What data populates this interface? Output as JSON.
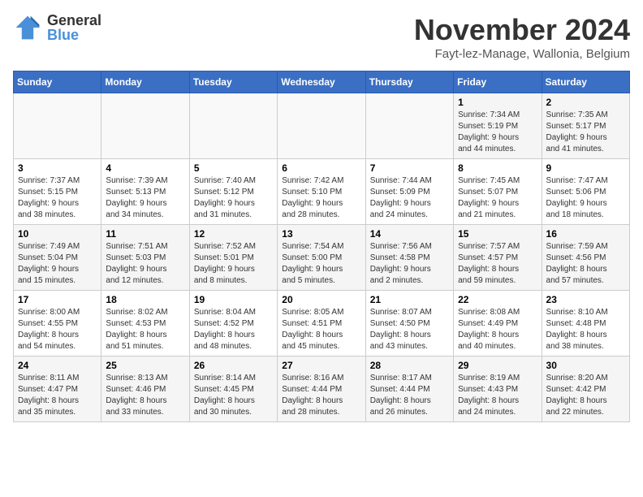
{
  "logo": {
    "general": "General",
    "blue": "Blue"
  },
  "title": "November 2024",
  "location": "Fayt-lez-Manage, Wallonia, Belgium",
  "weekdays": [
    "Sunday",
    "Monday",
    "Tuesday",
    "Wednesday",
    "Thursday",
    "Friday",
    "Saturday"
  ],
  "weeks": [
    [
      {
        "day": "",
        "info": ""
      },
      {
        "day": "",
        "info": ""
      },
      {
        "day": "",
        "info": ""
      },
      {
        "day": "",
        "info": ""
      },
      {
        "day": "",
        "info": ""
      },
      {
        "day": "1",
        "info": "Sunrise: 7:34 AM\nSunset: 5:19 PM\nDaylight: 9 hours\nand 44 minutes."
      },
      {
        "day": "2",
        "info": "Sunrise: 7:35 AM\nSunset: 5:17 PM\nDaylight: 9 hours\nand 41 minutes."
      }
    ],
    [
      {
        "day": "3",
        "info": "Sunrise: 7:37 AM\nSunset: 5:15 PM\nDaylight: 9 hours\nand 38 minutes."
      },
      {
        "day": "4",
        "info": "Sunrise: 7:39 AM\nSunset: 5:13 PM\nDaylight: 9 hours\nand 34 minutes."
      },
      {
        "day": "5",
        "info": "Sunrise: 7:40 AM\nSunset: 5:12 PM\nDaylight: 9 hours\nand 31 minutes."
      },
      {
        "day": "6",
        "info": "Sunrise: 7:42 AM\nSunset: 5:10 PM\nDaylight: 9 hours\nand 28 minutes."
      },
      {
        "day": "7",
        "info": "Sunrise: 7:44 AM\nSunset: 5:09 PM\nDaylight: 9 hours\nand 24 minutes."
      },
      {
        "day": "8",
        "info": "Sunrise: 7:45 AM\nSunset: 5:07 PM\nDaylight: 9 hours\nand 21 minutes."
      },
      {
        "day": "9",
        "info": "Sunrise: 7:47 AM\nSunset: 5:06 PM\nDaylight: 9 hours\nand 18 minutes."
      }
    ],
    [
      {
        "day": "10",
        "info": "Sunrise: 7:49 AM\nSunset: 5:04 PM\nDaylight: 9 hours\nand 15 minutes."
      },
      {
        "day": "11",
        "info": "Sunrise: 7:51 AM\nSunset: 5:03 PM\nDaylight: 9 hours\nand 12 minutes."
      },
      {
        "day": "12",
        "info": "Sunrise: 7:52 AM\nSunset: 5:01 PM\nDaylight: 9 hours\nand 8 minutes."
      },
      {
        "day": "13",
        "info": "Sunrise: 7:54 AM\nSunset: 5:00 PM\nDaylight: 9 hours\nand 5 minutes."
      },
      {
        "day": "14",
        "info": "Sunrise: 7:56 AM\nSunset: 4:58 PM\nDaylight: 9 hours\nand 2 minutes."
      },
      {
        "day": "15",
        "info": "Sunrise: 7:57 AM\nSunset: 4:57 PM\nDaylight: 8 hours\nand 59 minutes."
      },
      {
        "day": "16",
        "info": "Sunrise: 7:59 AM\nSunset: 4:56 PM\nDaylight: 8 hours\nand 57 minutes."
      }
    ],
    [
      {
        "day": "17",
        "info": "Sunrise: 8:00 AM\nSunset: 4:55 PM\nDaylight: 8 hours\nand 54 minutes."
      },
      {
        "day": "18",
        "info": "Sunrise: 8:02 AM\nSunset: 4:53 PM\nDaylight: 8 hours\nand 51 minutes."
      },
      {
        "day": "19",
        "info": "Sunrise: 8:04 AM\nSunset: 4:52 PM\nDaylight: 8 hours\nand 48 minutes."
      },
      {
        "day": "20",
        "info": "Sunrise: 8:05 AM\nSunset: 4:51 PM\nDaylight: 8 hours\nand 45 minutes."
      },
      {
        "day": "21",
        "info": "Sunrise: 8:07 AM\nSunset: 4:50 PM\nDaylight: 8 hours\nand 43 minutes."
      },
      {
        "day": "22",
        "info": "Sunrise: 8:08 AM\nSunset: 4:49 PM\nDaylight: 8 hours\nand 40 minutes."
      },
      {
        "day": "23",
        "info": "Sunrise: 8:10 AM\nSunset: 4:48 PM\nDaylight: 8 hours\nand 38 minutes."
      }
    ],
    [
      {
        "day": "24",
        "info": "Sunrise: 8:11 AM\nSunset: 4:47 PM\nDaylight: 8 hours\nand 35 minutes."
      },
      {
        "day": "25",
        "info": "Sunrise: 8:13 AM\nSunset: 4:46 PM\nDaylight: 8 hours\nand 33 minutes."
      },
      {
        "day": "26",
        "info": "Sunrise: 8:14 AM\nSunset: 4:45 PM\nDaylight: 8 hours\nand 30 minutes."
      },
      {
        "day": "27",
        "info": "Sunrise: 8:16 AM\nSunset: 4:44 PM\nDaylight: 8 hours\nand 28 minutes."
      },
      {
        "day": "28",
        "info": "Sunrise: 8:17 AM\nSunset: 4:44 PM\nDaylight: 8 hours\nand 26 minutes."
      },
      {
        "day": "29",
        "info": "Sunrise: 8:19 AM\nSunset: 4:43 PM\nDaylight: 8 hours\nand 24 minutes."
      },
      {
        "day": "30",
        "info": "Sunrise: 8:20 AM\nSunset: 4:42 PM\nDaylight: 8 hours\nand 22 minutes."
      }
    ]
  ]
}
